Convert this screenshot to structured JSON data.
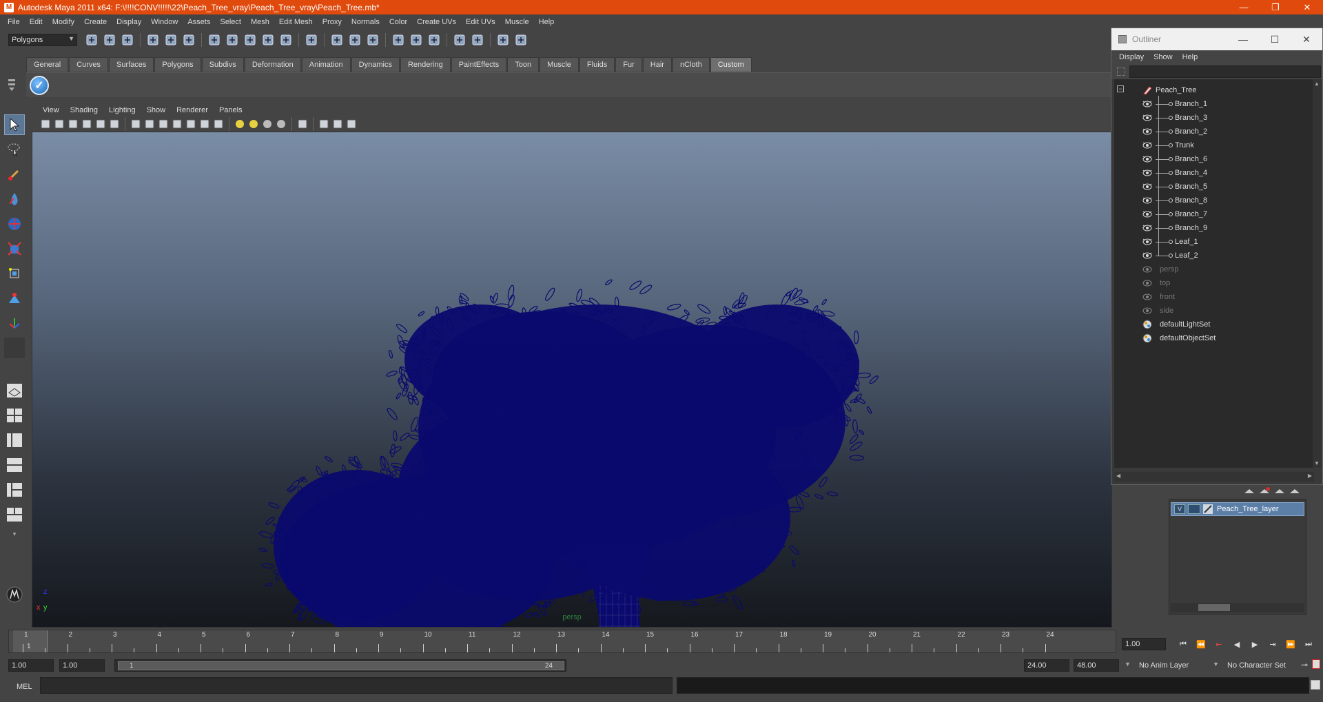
{
  "titlebar": {
    "title": "Autodesk Maya 2011 x64: F:\\!!!!CONV!!!!!\\22\\Peach_Tree_vray\\Peach_Tree_vray\\Peach_Tree.mb*",
    "min": "—",
    "restore": "❐",
    "close": "✕"
  },
  "menubar": [
    "File",
    "Edit",
    "Modify",
    "Create",
    "Display",
    "Window",
    "Assets",
    "Select",
    "Mesh",
    "Edit Mesh",
    "Proxy",
    "Normals",
    "Color",
    "Create UVs",
    "Edit UVs",
    "Muscle",
    "Help"
  ],
  "statusline": {
    "mode": "Polygons"
  },
  "shelf": {
    "tabs": [
      "General",
      "Curves",
      "Surfaces",
      "Polygons",
      "Subdivs",
      "Deformation",
      "Animation",
      "Dynamics",
      "Rendering",
      "PaintEffects",
      "Toon",
      "Muscle",
      "Fluids",
      "Fur",
      "Hair",
      "nCloth",
      "Custom"
    ],
    "active_tab": "Custom"
  },
  "viewport": {
    "menu": [
      "View",
      "Shading",
      "Lighting",
      "Show",
      "Renderer",
      "Panels"
    ],
    "camera_label": "persp",
    "wire_color": "#0a0a6e"
  },
  "timeline": {
    "frames": [
      "1",
      "2",
      "3",
      "4",
      "5",
      "6",
      "7",
      "8",
      "9",
      "10",
      "11",
      "12",
      "13",
      "14",
      "15",
      "16",
      "17",
      "18",
      "19",
      "20",
      "21",
      "22",
      "23",
      "24"
    ],
    "current_frame": "1",
    "current_time": "1.00"
  },
  "range": {
    "start_time": "1.00",
    "playback_start": "1.00",
    "slider_start": "1",
    "slider_end": "24",
    "playback_end": "24.00",
    "end_time": "48.00",
    "anim_layer": "No Anim Layer",
    "character_set": "No Character Set"
  },
  "mel": {
    "label": "MEL"
  },
  "outliner": {
    "title": "Outliner",
    "menu": [
      "Display",
      "Show",
      "Help"
    ],
    "root": "Peach_Tree",
    "children": [
      "Branch_1",
      "Branch_3",
      "Branch_2",
      "Trunk",
      "Branch_6",
      "Branch_4",
      "Branch_5",
      "Branch_8",
      "Branch_7",
      "Branch_9",
      "Leaf_1",
      "Leaf_2"
    ],
    "cameras": [
      "persp",
      "top",
      "front",
      "side"
    ],
    "sets": [
      "defaultLightSet",
      "defaultObjectSet"
    ]
  },
  "layers": {
    "visible_flag": "V",
    "name": "Peach_Tree_layer"
  },
  "colors": {
    "titlebar": "#e04a0c",
    "selection": "#5c7fa8",
    "ui_bg": "#444444"
  }
}
